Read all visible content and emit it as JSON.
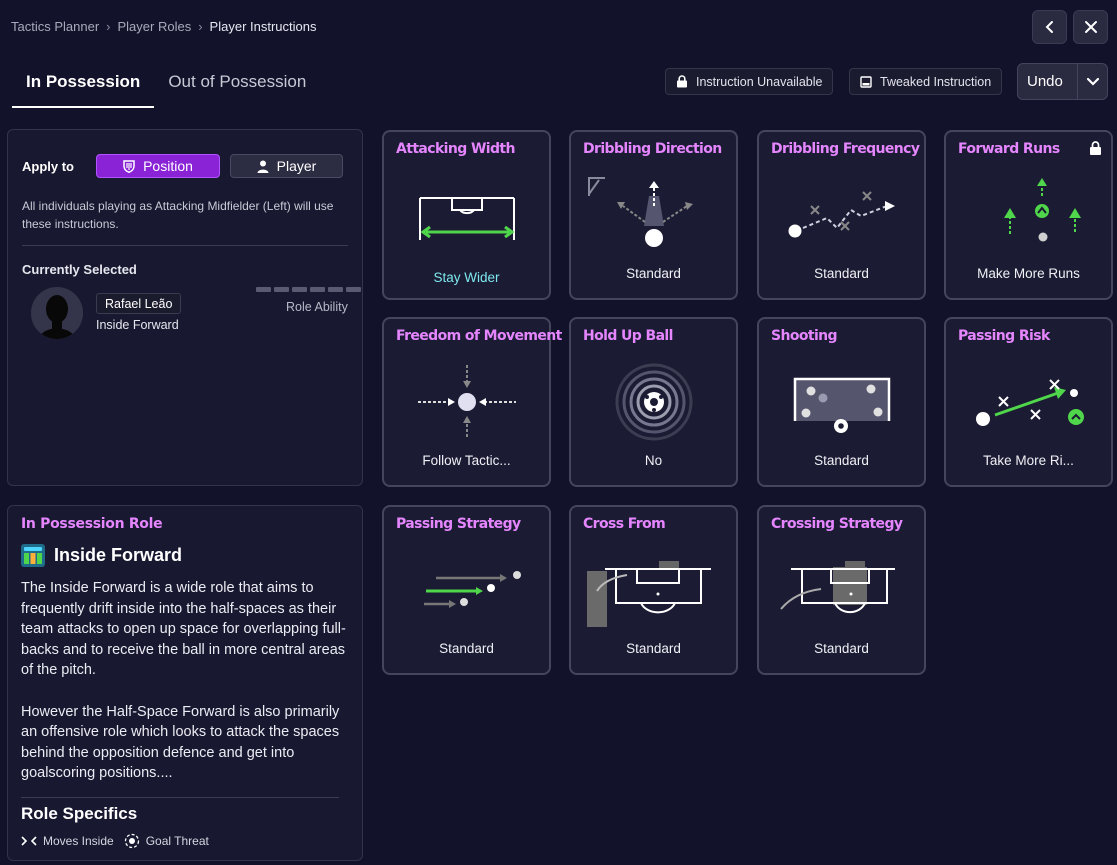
{
  "breadcrumb": [
    "Tactics Planner",
    "Player Roles",
    "Player Instructions"
  ],
  "tabs": [
    "In Possession",
    "Out of Possession"
  ],
  "legend": {
    "unavailable": "Instruction Unavailable",
    "tweaked": "Tweaked Instruction"
  },
  "undo_label": "Undo",
  "apply": {
    "label": "Apply to",
    "position": "Position",
    "player": "Player",
    "description": "All individuals playing as Attacking Midfielder (Left) will use these instructions."
  },
  "current": {
    "label": "Currently Selected",
    "player_name": "Rafael Leão",
    "player_role": "Inside Forward",
    "ability_label": "Role Ability"
  },
  "role": {
    "header": "In Possession Role",
    "title": "Inside Forward",
    "paragraphs": [
      "The Inside Forward is a wide role that aims to frequently drift inside into the half-spaces as their team attacks to open up space for overlapping full-backs and to receive the ball in more central areas of the pitch.",
      "However the Half-Space Forward is also primarily an offensive role which looks to attack the spaces behind the opposition defence and get into goalscoring positions...."
    ],
    "specifics_title": "Role Specifics",
    "specifics": [
      "Moves Inside",
      "Goal Threat"
    ]
  },
  "instructions": [
    {
      "title": "Attacking Width",
      "value": "Stay Wider",
      "icon": "attacking-width-diagram",
      "locked": false
    },
    {
      "title": "Dribbling Direction",
      "value": "Standard",
      "icon": "dribbling-direction-diagram",
      "locked": false
    },
    {
      "title": "Dribbling Frequency",
      "value": "Standard",
      "icon": "dribbling-frequency-diagram",
      "locked": false
    },
    {
      "title": "Forward Runs",
      "value": "Make More Runs",
      "icon": "forward-runs-diagram",
      "locked": true
    },
    {
      "title": "Freedom of Movement",
      "value": "Follow Tactic...",
      "icon": "freedom-of-movement-diagram",
      "locked": false
    },
    {
      "title": "Hold Up Ball",
      "value": "No",
      "icon": "hold-up-ball-diagram",
      "locked": false
    },
    {
      "title": "Shooting",
      "value": "Standard",
      "icon": "shooting-diagram",
      "locked": false
    },
    {
      "title": "Passing Risk",
      "value": "Take More Ri...",
      "icon": "passing-risk-diagram",
      "locked": false
    },
    {
      "title": "Passing Strategy",
      "value": "Standard",
      "icon": "passing-strategy-diagram",
      "locked": false
    },
    {
      "title": "Cross From",
      "value": "Standard",
      "icon": "cross-from-diagram",
      "locked": false
    },
    {
      "title": "Crossing Strategy",
      "value": "Standard",
      "icon": "crossing-strategy-diagram",
      "locked": false
    }
  ],
  "colors": {
    "accent": "#e586ff",
    "toggle_active": "#8a22d6",
    "highlight_green": "#4fd64a",
    "value_alt": "#7de8ee"
  }
}
